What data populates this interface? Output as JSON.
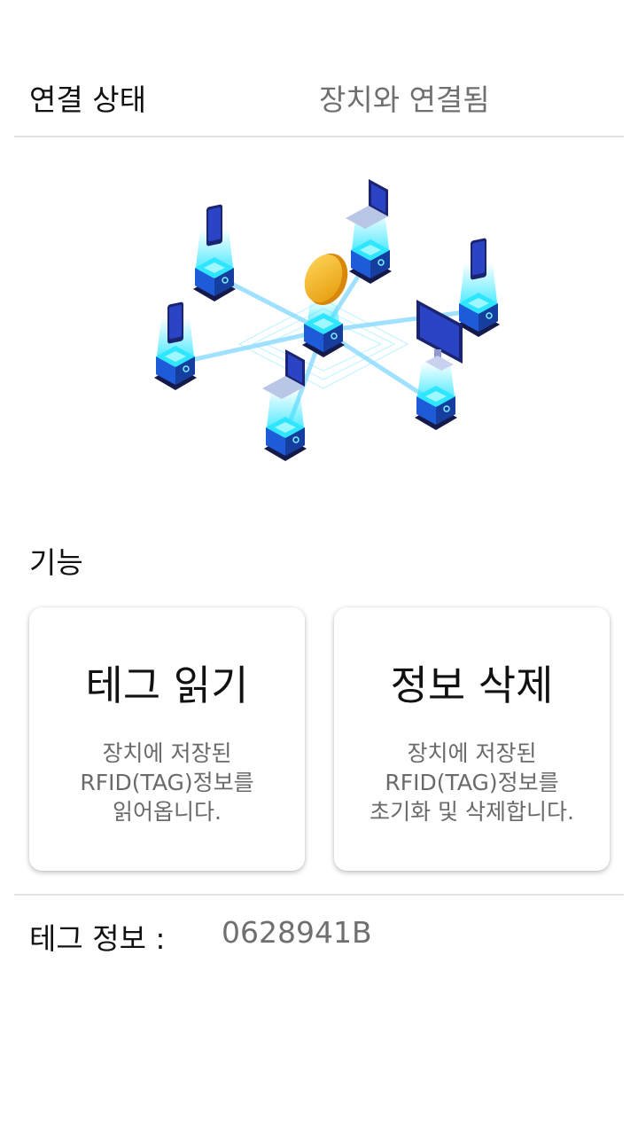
{
  "status": {
    "label": "연결 상태",
    "value": "장치와 연결됨"
  },
  "illustration": {
    "name": "network-devices-illustration"
  },
  "functions": {
    "title": "기능",
    "cards": [
      {
        "title": "테그 읽기",
        "desc": [
          "장치에 저장된",
          "RFID(TAG)정보를",
          "읽어옵니다."
        ]
      },
      {
        "title": "정보 삭제",
        "desc": [
          "장치에 저장된",
          "RFID(TAG)정보를",
          "초기화 및 삭제합니다."
        ]
      }
    ]
  },
  "tag_info": {
    "label": "테그 정보 :",
    "value": "0628941B"
  },
  "colors": {
    "text_primary": "#111111",
    "text_secondary": "#6f6f6f",
    "divider": "#e2e2e2",
    "accent_blue": "#1e5bd8",
    "glow": "#2ee6ff",
    "coin": "#f2b21b"
  }
}
